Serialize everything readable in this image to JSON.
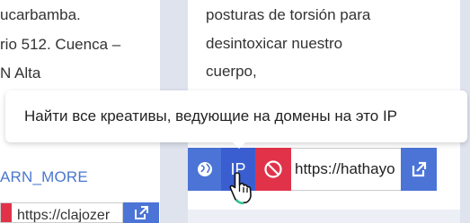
{
  "left_card": {
    "lines": [
      "ucarbamba.",
      "rio 512. Cuenca –",
      "N Alta"
    ],
    "learn_more": "ARN_MORE",
    "url": "https://clajozer"
  },
  "right_card": {
    "lines": [
      "posturas de torsión para",
      "desintoxicar nuestro",
      "cuerpo,"
    ],
    "ip_label": "IP",
    "url": "https://hathayo"
  },
  "tooltip": {
    "text": "Найти все креативы, ведующие на домены на это IP"
  },
  "colors": {
    "blue": "#4b74d6",
    "blue_active": "#3a5ed0",
    "red": "#e0334a",
    "background": "#dfe3ee"
  },
  "icons": [
    "globe-icon",
    "ban-icon",
    "external-link-icon",
    "hand-cursor-icon"
  ]
}
